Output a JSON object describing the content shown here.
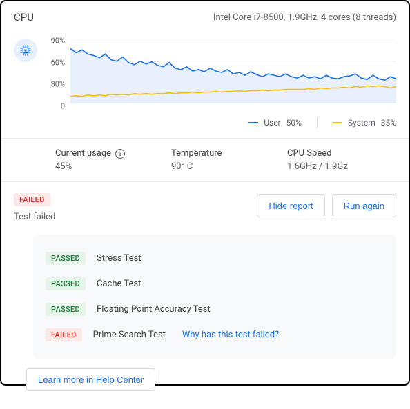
{
  "header": {
    "title": "CPU",
    "spec": "Intel Core i7-8500, 1.9GHz, 4 cores (8 threads)"
  },
  "chart_data": {
    "type": "line",
    "ylim": [
      0,
      90
    ],
    "yticks": [
      "90%",
      "60%",
      "30%",
      "0"
    ],
    "series": [
      {
        "name": "User",
        "color": "#1a73e8",
        "legend_value": "50%",
        "values": [
          78,
          72,
          76,
          70,
          68,
          65,
          70,
          62,
          60,
          66,
          58,
          55,
          60,
          56,
          59,
          54,
          52,
          58,
          50,
          48,
          52,
          46,
          48,
          45,
          50,
          46,
          44,
          48,
          42,
          44,
          40,
          45,
          41,
          38,
          42,
          40,
          38,
          42,
          38,
          36,
          40,
          36,
          38,
          35,
          40,
          36,
          35,
          38,
          39,
          42,
          36,
          34,
          40,
          35,
          33,
          38,
          35
        ]
      },
      {
        "name": "System",
        "color": "#fbbc04",
        "legend_value": "35%",
        "values": [
          10,
          11,
          10,
          12,
          11,
          12,
          11,
          13,
          12,
          13,
          12,
          14,
          13,
          14,
          13,
          14,
          14,
          15,
          14,
          15,
          15,
          16,
          15,
          16,
          16,
          17,
          16,
          17,
          17,
          18,
          17,
          18,
          18,
          19,
          18,
          19,
          19,
          20,
          20,
          20,
          20,
          21,
          20,
          22,
          21,
          22,
          22,
          23,
          22,
          24,
          23,
          25,
          24,
          25,
          24,
          22,
          24
        ]
      }
    ]
  },
  "legend": {
    "user_label": "User",
    "user_value": "50%",
    "system_label": "System",
    "system_value": "35%"
  },
  "stats": {
    "usage_label": "Current usage",
    "usage_value": "45%",
    "temp_label": "Temperature",
    "temp_value": "90° C",
    "speed_label": "CPU Speed",
    "speed_value": "1.6GHz / 1.9Gz"
  },
  "test": {
    "status_badge": "FAILED",
    "status_text": "Test failed",
    "hide_label": "Hide report",
    "run_label": "Run again",
    "items": [
      {
        "badge": "PASSED",
        "name": "Stress Test"
      },
      {
        "badge": "PASSED",
        "name": "Cache Test"
      },
      {
        "badge": "PASSED",
        "name": "Floating Point Accuracy Test"
      },
      {
        "badge": "FAILED",
        "name": "Prime Search Test",
        "link": "Why has this test failed?"
      }
    ],
    "learn_more": "Learn more in Help Center"
  }
}
